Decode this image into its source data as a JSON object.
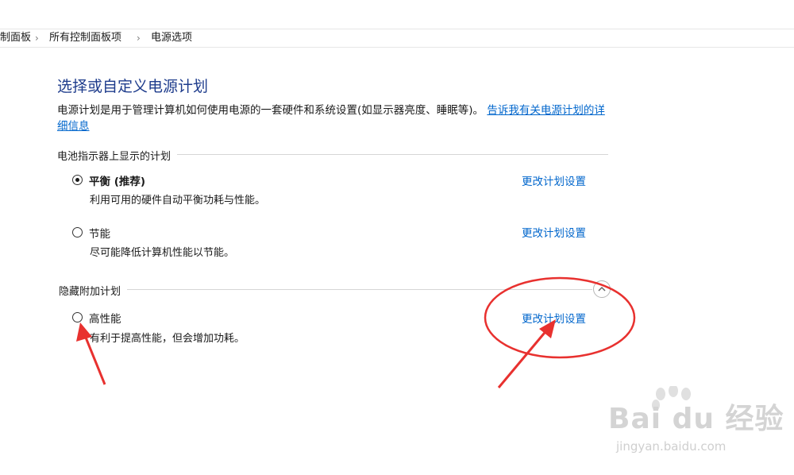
{
  "breadcrumb": {
    "items": [
      "制面板",
      "所有控制面板项",
      "电源选项"
    ],
    "separator": "›"
  },
  "page": {
    "title": "选择或自定义电源计划",
    "description": "电源计划是用于管理计算机如何使用电源的一套硬件和系统设置(如显示器亮度、睡眠等)。",
    "help_link": "告诉我有关电源计划的详细信息"
  },
  "sections": {
    "battery": {
      "heading": "电池指示器上显示的计划",
      "plans": [
        {
          "name": "平衡 (推荐)",
          "desc": "利用可用的硬件自动平衡功耗与性能。",
          "link": "更改计划设置",
          "selected": true
        },
        {
          "name": "节能",
          "desc": "尽可能降低计算机性能以节能。",
          "link": "更改计划设置",
          "selected": false
        }
      ]
    },
    "hidden": {
      "heading": "隐藏附加计划",
      "collapse_icon": "chevron-up-icon",
      "plans": [
        {
          "name": "高性能",
          "desc": "有利于提高性能，但会增加功耗。",
          "link": "更改计划设置",
          "selected": false
        }
      ]
    }
  },
  "watermark": {
    "logo": "Bai du 经验",
    "url": "jingyan.baidu.com"
  },
  "colors": {
    "title": "#1e3c8c",
    "link": "#0066cc",
    "annotation": "#e8312f"
  }
}
